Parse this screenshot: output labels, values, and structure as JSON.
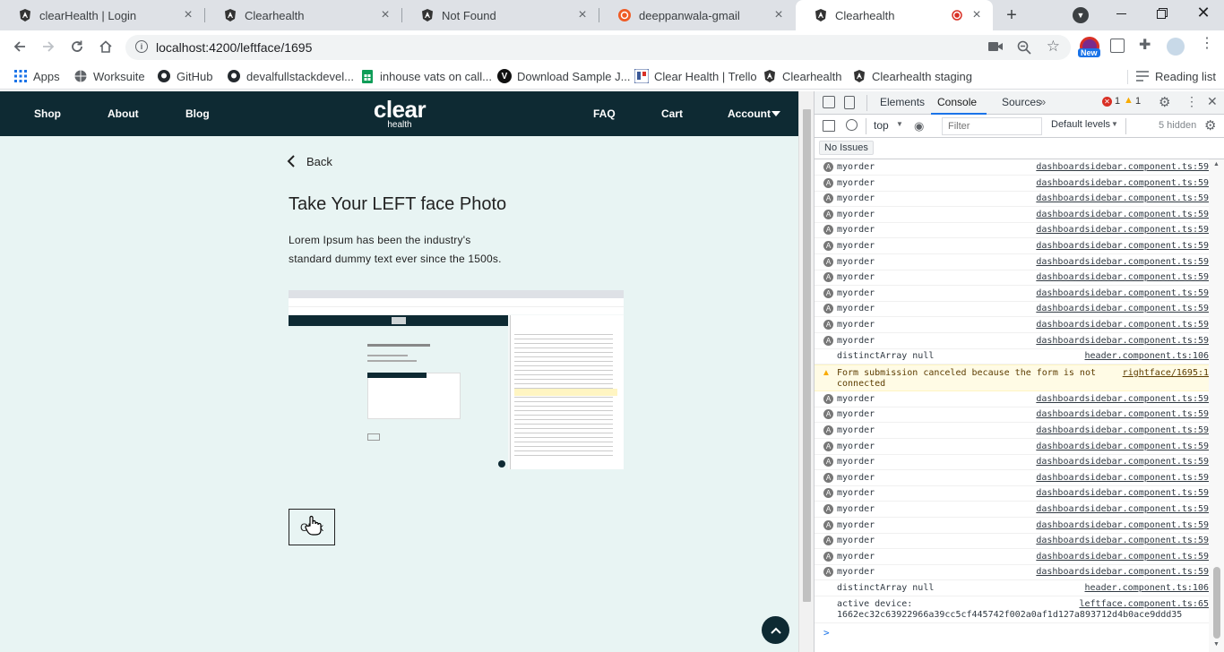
{
  "browser": {
    "tabs": [
      {
        "title": "clearHealth | Login",
        "icon": "angular-icon"
      },
      {
        "title": "Clearhealth",
        "icon": "angular-icon"
      },
      {
        "title": "Not Found",
        "icon": "angular-icon"
      },
      {
        "title": "deeppanwala-gmail",
        "icon": "postman-icon"
      },
      {
        "title": "Clearhealth",
        "icon": "angular-icon",
        "active": true
      }
    ],
    "url": "localhost:4200/leftface/1695",
    "new_badge": "New",
    "reading_list": "Reading list",
    "bookmarks": [
      {
        "label": "Apps",
        "icon": "apps-grid-icon"
      },
      {
        "label": "Worksuite",
        "icon": "globe-icon"
      },
      {
        "label": "GitHub",
        "icon": "github-icon"
      },
      {
        "label": "devalfullstackdevel...",
        "icon": "github-icon"
      },
      {
        "label": "inhouse vats on call...",
        "icon": "sheets-icon"
      },
      {
        "label": "Download Sample J...",
        "icon": "v-logo-icon"
      },
      {
        "label": "Clear Health | Trello",
        "icon": "trello-icon"
      },
      {
        "label": "Clearhealth",
        "icon": "angular-icon"
      },
      {
        "label": "Clearhealth staging",
        "icon": "angular-icon"
      }
    ]
  },
  "site": {
    "nav_left": [
      "Shop",
      "About",
      "Blog"
    ],
    "logo_main": "clear",
    "logo_sub": "health",
    "nav_right": [
      "FAQ",
      "Cart",
      "Account"
    ],
    "back_label": "Back",
    "title": "Take Your LEFT face Photo",
    "description_line1": "Lorem Ipsum has been the industry's",
    "description_line2": "standard dummy text ever since the 1500s.",
    "click_button": "Click"
  },
  "devtools": {
    "tabs": [
      "Elements",
      "Console",
      "Sources"
    ],
    "active_tab": "Console",
    "error_count": "1",
    "warning_count": "1",
    "context": "top",
    "filter_placeholder": "Filter",
    "levels": "Default levels",
    "hidden": "5 hidden",
    "issues": "No Issues",
    "messages": [
      {
        "text": "myorder",
        "src": "dashboardsidebar.component.ts:59",
        "icon": true
      },
      {
        "text": "myorder",
        "src": "dashboardsidebar.component.ts:59",
        "icon": true
      },
      {
        "text": "myorder",
        "src": "dashboardsidebar.component.ts:59",
        "icon": true
      },
      {
        "text": "myorder",
        "src": "dashboardsidebar.component.ts:59",
        "icon": true
      },
      {
        "text": "myorder",
        "src": "dashboardsidebar.component.ts:59",
        "icon": true
      },
      {
        "text": "myorder",
        "src": "dashboardsidebar.component.ts:59",
        "icon": true
      },
      {
        "text": "myorder",
        "src": "dashboardsidebar.component.ts:59",
        "icon": true
      },
      {
        "text": "myorder",
        "src": "dashboardsidebar.component.ts:59",
        "icon": true
      },
      {
        "text": "myorder",
        "src": "dashboardsidebar.component.ts:59",
        "icon": true
      },
      {
        "text": "myorder",
        "src": "dashboardsidebar.component.ts:59",
        "icon": true
      },
      {
        "text": "myorder",
        "src": "dashboardsidebar.component.ts:59",
        "icon": true
      },
      {
        "text": "myorder",
        "src": "dashboardsidebar.component.ts:59",
        "icon": true
      },
      {
        "text": "distinctArray null",
        "src": "header.component.ts:106",
        "icon": false
      },
      {
        "text": "Form submission canceled because the form is not",
        "text2": "connected",
        "src": "rightface/1695:1",
        "warn": true
      },
      {
        "text": "myorder",
        "src": "dashboardsidebar.component.ts:59",
        "icon": true
      },
      {
        "text": "myorder",
        "src": "dashboardsidebar.component.ts:59",
        "icon": true
      },
      {
        "text": "myorder",
        "src": "dashboardsidebar.component.ts:59",
        "icon": true
      },
      {
        "text": "myorder",
        "src": "dashboardsidebar.component.ts:59",
        "icon": true
      },
      {
        "text": "myorder",
        "src": "dashboardsidebar.component.ts:59",
        "icon": true
      },
      {
        "text": "myorder",
        "src": "dashboardsidebar.component.ts:59",
        "icon": true
      },
      {
        "text": "myorder",
        "src": "dashboardsidebar.component.ts:59",
        "icon": true
      },
      {
        "text": "myorder",
        "src": "dashboardsidebar.component.ts:59",
        "icon": true
      },
      {
        "text": "myorder",
        "src": "dashboardsidebar.component.ts:59",
        "icon": true
      },
      {
        "text": "myorder",
        "src": "dashboardsidebar.component.ts:59",
        "icon": true
      },
      {
        "text": "myorder",
        "src": "dashboardsidebar.component.ts:59",
        "icon": true
      },
      {
        "text": "myorder",
        "src": "dashboardsidebar.component.ts:59",
        "icon": true
      },
      {
        "text": "distinctArray null",
        "src": "header.component.ts:106",
        "icon": false
      },
      {
        "text": "active device:",
        "text2": "1662ec32c63922966a39cc5cf445742f002a0af1d127a893712d4b0ace9ddd35",
        "src": "leftface.component.ts:65",
        "icon": false
      }
    ],
    "prompt": ">"
  },
  "colors": {
    "site_nav": "#0e2a33",
    "page_bg": "#e8f4f3",
    "warn_bg": "#fffbe5"
  }
}
